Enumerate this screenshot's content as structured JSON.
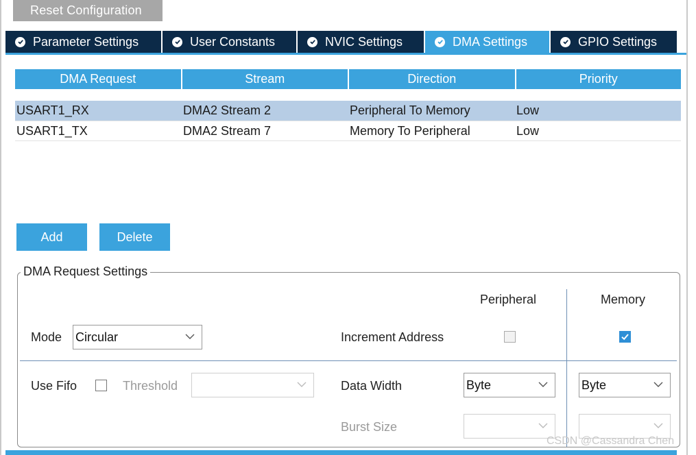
{
  "toolbar": {
    "reset_label": "Reset Configuration"
  },
  "tabs": [
    {
      "label": "Parameter Settings",
      "active": false
    },
    {
      "label": "User Constants",
      "active": false
    },
    {
      "label": "NVIC Settings",
      "active": false
    },
    {
      "label": "DMA Settings",
      "active": true
    },
    {
      "label": "GPIO Settings",
      "active": false
    }
  ],
  "table": {
    "headers": [
      "DMA Request",
      "Stream",
      "Direction",
      "Priority"
    ],
    "rows": [
      {
        "cells": [
          "USART1_RX",
          "DMA2 Stream 2",
          "Peripheral To Memory",
          "Low"
        ],
        "selected": true
      },
      {
        "cells": [
          "USART1_TX",
          "DMA2 Stream 7",
          "Memory To Peripheral",
          "Low"
        ],
        "selected": false
      }
    ]
  },
  "actions": {
    "add_label": "Add",
    "delete_label": "Delete"
  },
  "settings": {
    "group_title": "DMA Request Settings",
    "col_peripheral": "Peripheral",
    "col_memory": "Memory",
    "mode_label": "Mode",
    "mode_value": "Circular",
    "increment_label": "Increment Address",
    "increment_peripheral": false,
    "increment_memory": true,
    "fifo_label": "Use Fifo",
    "fifo_checked": false,
    "threshold_label": "Threshold",
    "threshold_value": "",
    "data_width_label": "Data Width",
    "data_width_peripheral": "Byte",
    "data_width_memory": "Byte",
    "burst_label": "Burst Size",
    "burst_peripheral": "",
    "burst_memory": ""
  },
  "watermark": "CSDN @Cassandra Chen",
  "colors": {
    "accent": "#3ba3dd",
    "tab_dark": "#0c2a48",
    "selected_row": "#b7cde5",
    "reset_button": "#a7a7a7"
  },
  "icons": {
    "tab_check": "check-circle-icon",
    "dropdown": "chevron-down-icon",
    "checkbox_checked": "checkmark-icon"
  }
}
